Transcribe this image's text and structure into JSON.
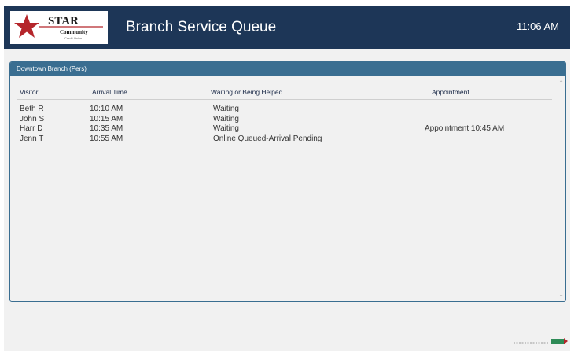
{
  "header": {
    "logo": {
      "name": "STAR",
      "line2": "Community",
      "line3": "Credit Union"
    },
    "title": "Branch Service Queue",
    "time": "11:06 AM"
  },
  "panel": {
    "title": "Downtown Branch (Pers)",
    "columns": {
      "visitor": "Visitor",
      "arrival": "Arrival Time",
      "status": "Waiting or Being Helped",
      "appointment": "Appointment"
    },
    "rows": [
      {
        "visitor": "Beth R",
        "arrival": "10:10 AM",
        "status": "Waiting",
        "appointment": ""
      },
      {
        "visitor": "John S",
        "arrival": "10:15 AM",
        "status": "Waiting",
        "appointment": ""
      },
      {
        "visitor": "Harr D",
        "arrival": "10:35 AM",
        "status": "Waiting",
        "appointment": "Appointment 10:45 AM"
      },
      {
        "visitor": "Jenn T",
        "arrival": "10:55 AM",
        "status": "Online Queued-Arrival Pending",
        "appointment": ""
      }
    ]
  },
  "colors": {
    "header_bg": "#1d3657",
    "panel_accent": "#3a6e91",
    "brand_red": "#b5262b"
  },
  "icons": {
    "logo": "star-logo-icon",
    "scroll_up": "chevron-up-icon",
    "scroll_down": "chevron-down-icon",
    "footer": "vendor-logo-icon"
  }
}
